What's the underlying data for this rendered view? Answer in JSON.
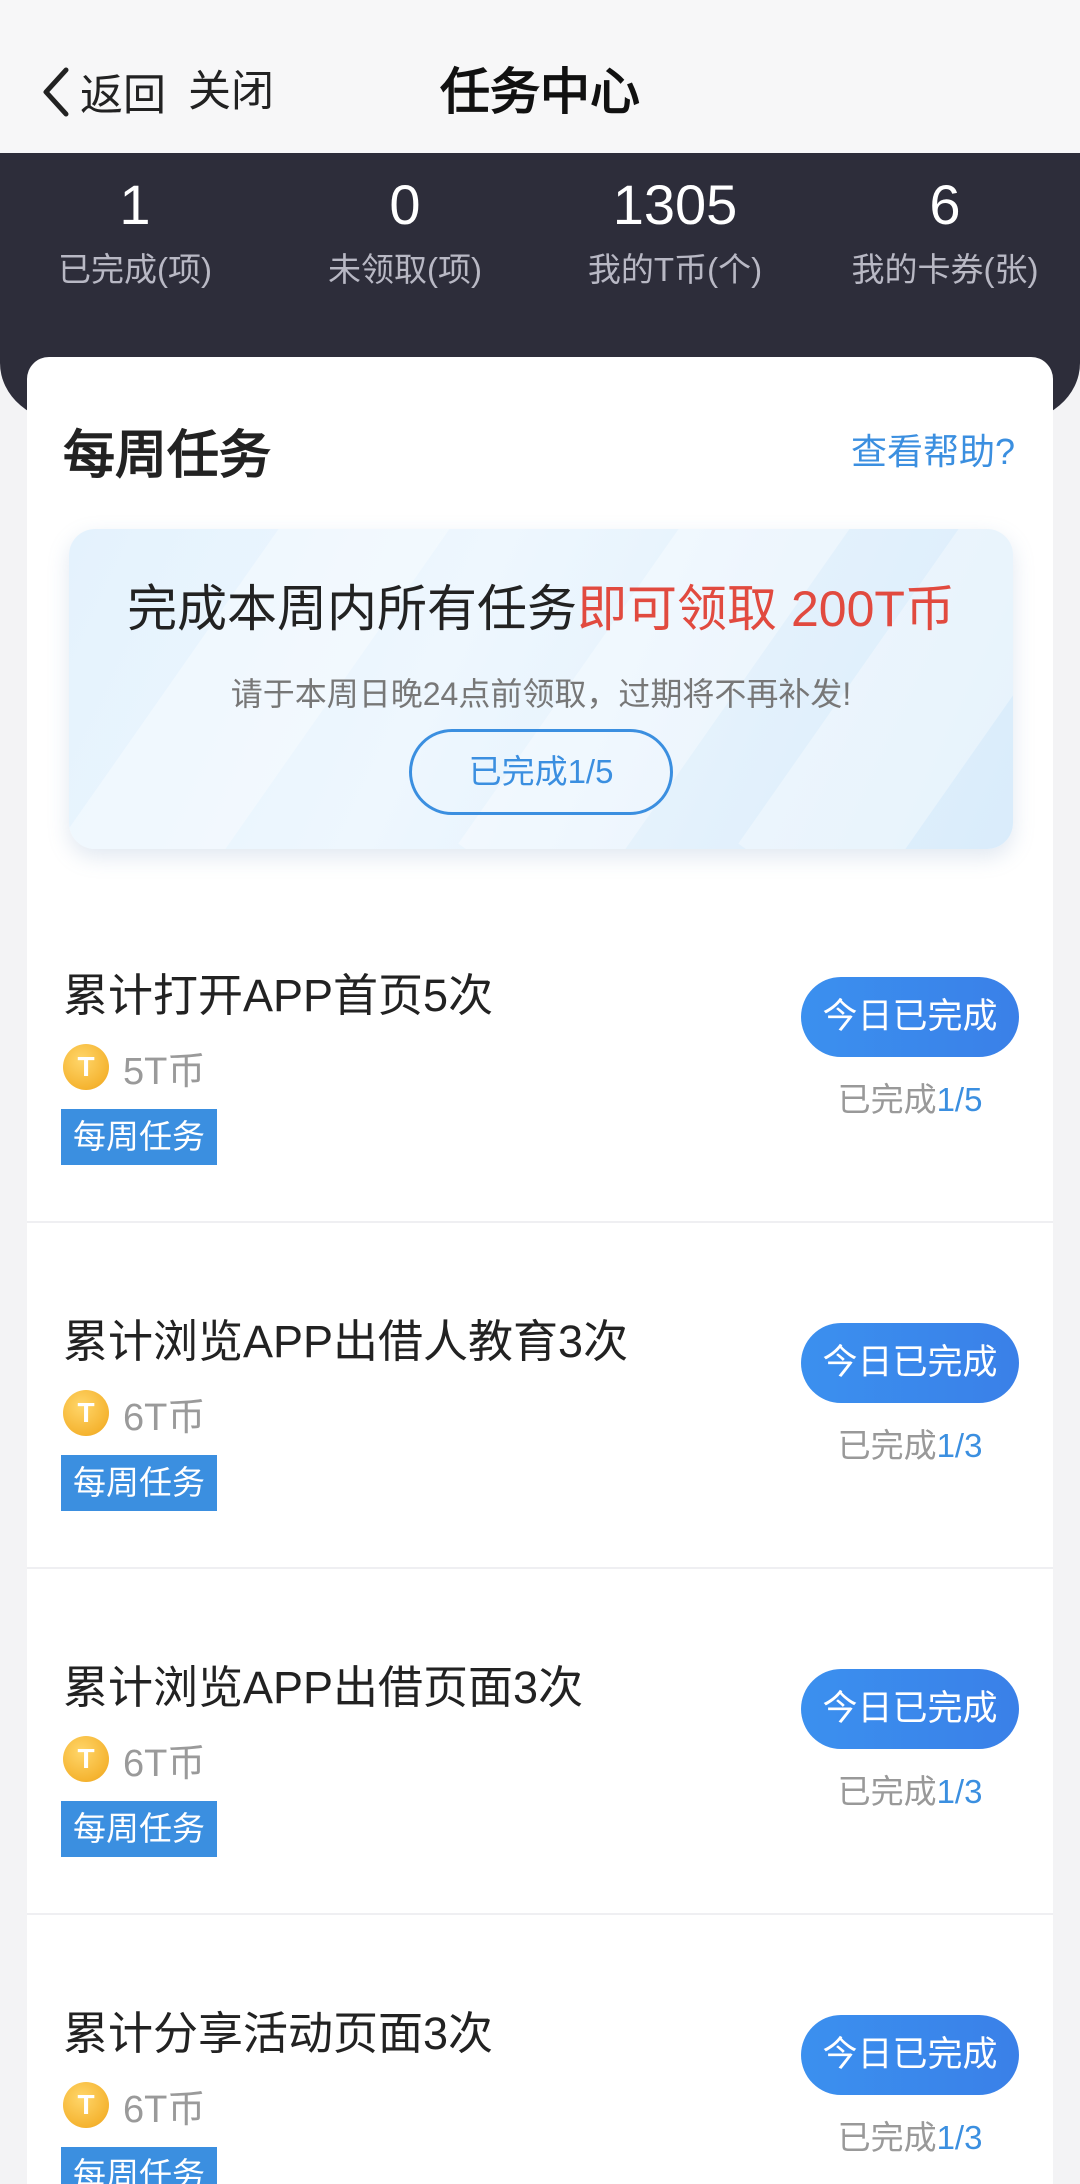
{
  "nav": {
    "back_label": "返回",
    "close_label": "关闭",
    "title": "任务中心"
  },
  "stats": [
    {
      "value": "1",
      "label": "已完成(项)"
    },
    {
      "value": "0",
      "label": "未领取(项)"
    },
    {
      "value": "1305",
      "label": "我的T币(个)"
    },
    {
      "value": "6",
      "label": "我的卡券(张)"
    }
  ],
  "section": {
    "title": "每周任务",
    "help_link": "查看帮助?"
  },
  "banner": {
    "text_main": "完成本周内所有任务",
    "text_highlight": "即可领取 200T币",
    "subtitle": "请于本周日晚24点前领取，过期将不再补发!",
    "progress_label": "已完成1/5"
  },
  "coin_icon_letter": "T",
  "tasks": [
    {
      "title": "累计打开APP首页5次",
      "reward": "5T币",
      "tag": "每周任务",
      "button": "今日已完成",
      "progress_prefix": "已完成",
      "progress_count": "1/5"
    },
    {
      "title": "累计浏览APP出借人教育3次",
      "reward": "6T币",
      "tag": "每周任务",
      "button": "今日已完成",
      "progress_prefix": "已完成",
      "progress_count": "1/3"
    },
    {
      "title": "累计浏览APP出借页面3次",
      "reward": "6T币",
      "tag": "每周任务",
      "button": "今日已完成",
      "progress_prefix": "已完成",
      "progress_count": "1/3"
    },
    {
      "title": "累计分享活动页面3次",
      "reward": "6T币",
      "tag": "每周任务",
      "button": "今日已完成",
      "progress_prefix": "已完成",
      "progress_count": "1/3"
    }
  ],
  "colors": {
    "accent": "#3b8fe0",
    "highlight_red": "#e14a3f",
    "header_dark": "#2d2d3a",
    "coin_gold": "#f5b431"
  }
}
